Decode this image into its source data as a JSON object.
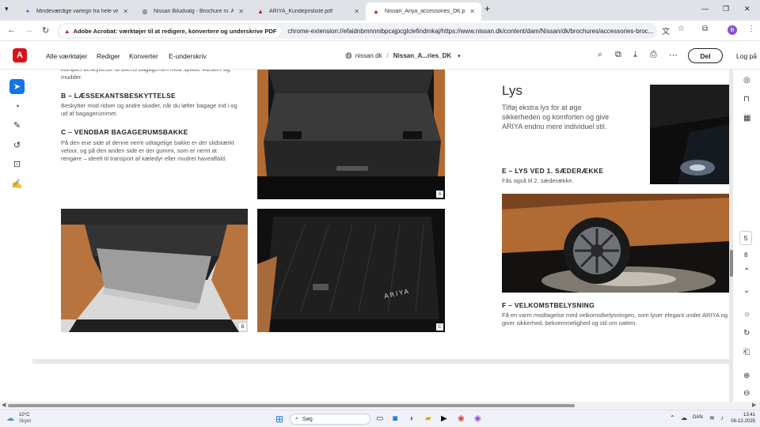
{
  "browser": {
    "tabs": [
      {
        "title": "Mindeværdige vartegn fra hele verd",
        "active": false
      },
      {
        "title": "Nissan Biludvalg - Brochure m. Alle",
        "active": false
      },
      {
        "title": "ARIYA_Kundeprisliste.pdf",
        "active": false
      },
      {
        "title": "Nissan_Ariya_accessories_DK.pdf",
        "active": true
      }
    ],
    "new_tab": "+",
    "extension_chip": "Adobe Acrobat: værktøjer til at redigere, konvertere og underskrive PDF",
    "url": "chrome-extension://efaidnbmnnnibpcajpcglclefindmkaj/https://www.nissan.dk/content/dam/Nissan/dk/brochures/accessories-broc...",
    "profile_initial": "B"
  },
  "acrobat": {
    "menu": [
      "Alle værktøjer",
      "Rediger",
      "Konverter",
      "E-underskriv"
    ],
    "domain": "nissan.dk",
    "separator": "/",
    "doc_name": "Nissan_A...ries_DK",
    "share_label": "Del",
    "login_label": "Log på",
    "page_number": "5",
    "page_total": "8"
  },
  "pdf": {
    "intro_fragment": "komplet beskyttelse af bilens bagagerum mod spildte væsker og mudder.",
    "section_b_title": "B – LÆSSEKANTSBESKYTTELSE",
    "section_b_text": "Beskytter mod ridser og andre skader, når du løfter bagage ind i og ud af bagagerummet.",
    "section_c_title": "C – VENDBAR BAGAGERUMSBAKKE",
    "section_c_text": "På den ene side af denne nemt udtagelige bakke er der slidstærkt velour, og på den anden side er der gummi, som er nemt at rengøre – ideelt til transport af kæledyr eller mudret haveaffald.",
    "tag_a": "A",
    "tag_b": "B",
    "tag_c": "C",
    "lys_title": "Lys",
    "lys_text": "Tilføj ekstra lys for at øge sikkerheden og komforten og give ARIYA endnu mere individuel stil.",
    "section_e_title": "E – LYS VED 1. SÆDERÆKKE",
    "section_e_text": "Fås også til 2. sæderække.",
    "section_f_title": "F – VELKOMSTBELYSNING",
    "section_f_text": "Få en varm modtagelse med velkomstbelysningen, som lyser elegant under ARIYA og giver sikkerhed, bekvemmelighed og stil om natten.",
    "mat_logo": "ARIYA"
  },
  "taskbar": {
    "weather_temp": "10°C",
    "weather_desc": "Skyet",
    "search_label": "Søg",
    "language": "DAN",
    "time": "13:41",
    "date": "08-12-2025"
  }
}
